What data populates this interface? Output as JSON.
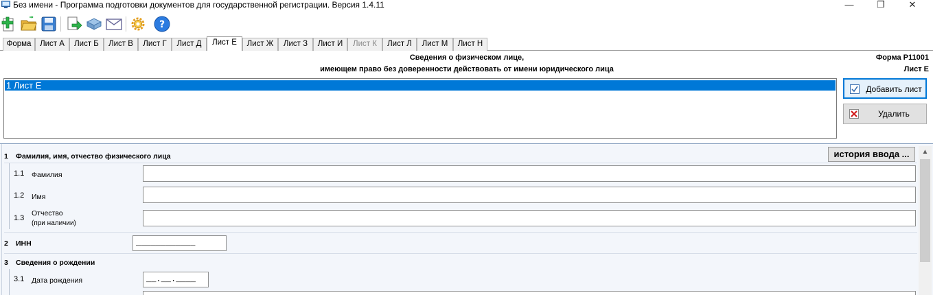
{
  "window": {
    "title": "Без имени - Программа подготовки документов для государственной регистрации. Версия 1.4.11",
    "minimize": "—",
    "maximize": "❐",
    "close": "✕"
  },
  "toolbar": {
    "buttons": [
      "new-document-icon",
      "open-folder-icon",
      "save-icon",
      "export-icon",
      "print-icon",
      "email-icon",
      "settings-icon",
      "help-icon"
    ]
  },
  "tabs": [
    {
      "label": "Форма",
      "state": "normal"
    },
    {
      "label": "Лист А",
      "state": "normal"
    },
    {
      "label": "Лист Б",
      "state": "normal"
    },
    {
      "label": "Лист В",
      "state": "normal"
    },
    {
      "label": "Лист Г",
      "state": "normal"
    },
    {
      "label": "Лист Д",
      "state": "normal"
    },
    {
      "label": "Лист Е",
      "state": "active"
    },
    {
      "label": "Лист Ж",
      "state": "normal"
    },
    {
      "label": "Лист З",
      "state": "normal"
    },
    {
      "label": "Лист И",
      "state": "normal"
    },
    {
      "label": "Лист К",
      "state": "disabled"
    },
    {
      "label": "Лист Л",
      "state": "normal"
    },
    {
      "label": "Лист М",
      "state": "normal"
    },
    {
      "label": "Лист Н",
      "state": "normal"
    }
  ],
  "header": {
    "line1": "Сведения о физическом лице,",
    "line2": "имеющем право без доверенности действовать от имени юридического лица",
    "form_code": "Форма Р11001",
    "sheet_code": "Лист Е"
  },
  "sheet_list": {
    "items": [
      "1 Лист Е"
    ],
    "selected_index": 0
  },
  "side_buttons": {
    "add_label": "Добавить лист",
    "delete_label": "Удалить"
  },
  "form": {
    "history_button": "история ввода ...",
    "section1": {
      "num": "1",
      "title": "Фамилия, имя, отчество физического лица",
      "rows": [
        {
          "num": "1.1",
          "label": "Фамилия",
          "value": ""
        },
        {
          "num": "1.2",
          "label": "Имя",
          "value": ""
        },
        {
          "num": "1.3",
          "label": "Отчество",
          "label2": "(при наличии)",
          "value": ""
        }
      ]
    },
    "section2": {
      "num": "2",
      "title": "ИНН",
      "value": "____________"
    },
    "section3": {
      "num": "3",
      "title": "Сведения о рождении",
      "rows": [
        {
          "num": "3.1",
          "label": "Дата рождения",
          "value": "__.__.____"
        }
      ]
    }
  },
  "colors": {
    "selection": "#0078d7",
    "panel_bg": "#f3f6fb",
    "tab_bg": "#f0f0f0"
  }
}
